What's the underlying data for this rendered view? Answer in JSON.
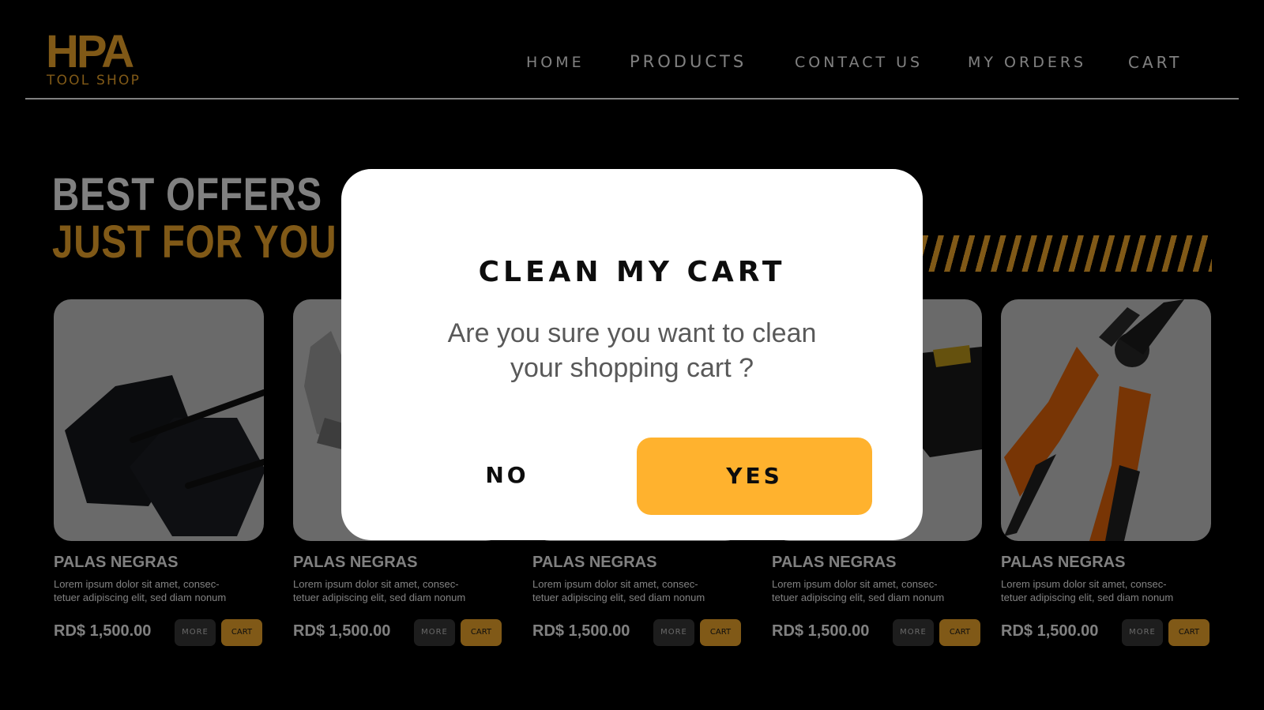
{
  "brand": {
    "logo_mark": "HPA",
    "logo_sub": "TOOL SHOP"
  },
  "nav": {
    "home": "HOME",
    "products": "PRODUCTS",
    "contact": "CONTACT US",
    "orders": "MY ORDERS",
    "cart": "CART"
  },
  "hero": {
    "line1": "BEST OFFERS",
    "line2": "JUST FOR YOU"
  },
  "products": [
    {
      "title": "PALAS NEGRAS",
      "desc1": "Lorem ipsum dolor sit amet, consec-",
      "desc2": "tetuer adipiscing elit, sed diam nonum",
      "price": "RD$ 1,500.00",
      "more": "MORE",
      "cart": "CART"
    },
    {
      "title": "PALAS NEGRAS",
      "desc1": "Lorem ipsum dolor sit amet, consec-",
      "desc2": "tetuer adipiscing elit, sed diam nonum",
      "price": "RD$ 1,500.00",
      "more": "MORE",
      "cart": "CART"
    },
    {
      "title": "PALAS NEGRAS",
      "desc1": "Lorem ipsum dolor sit amet, consec-",
      "desc2": "tetuer adipiscing elit, sed diam nonum",
      "price": "RD$ 1,500.00",
      "more": "MORE",
      "cart": "CART"
    },
    {
      "title": "PALAS NEGRAS",
      "desc1": "Lorem ipsum dolor sit amet, consec-",
      "desc2": "tetuer adipiscing elit, sed diam nonum",
      "price": "RD$ 1,500.00",
      "more": "MORE",
      "cart": "CART"
    },
    {
      "title": "PALAS NEGRAS",
      "desc1": "Lorem ipsum dolor sit amet, consec-",
      "desc2": "tetuer adipiscing elit, sed diam nonum",
      "price": "RD$ 1,500.00",
      "more": "MORE",
      "cart": "CART"
    }
  ],
  "modal": {
    "title": "CLEAN MY CART",
    "message_line1": "Are you sure you want to clean",
    "message_line2": "your shopping cart ?",
    "no_label": "NO",
    "yes_label": "YES"
  },
  "colors": {
    "accent": "#ffb22e",
    "background": "#000000",
    "modal": "#ffffff"
  }
}
